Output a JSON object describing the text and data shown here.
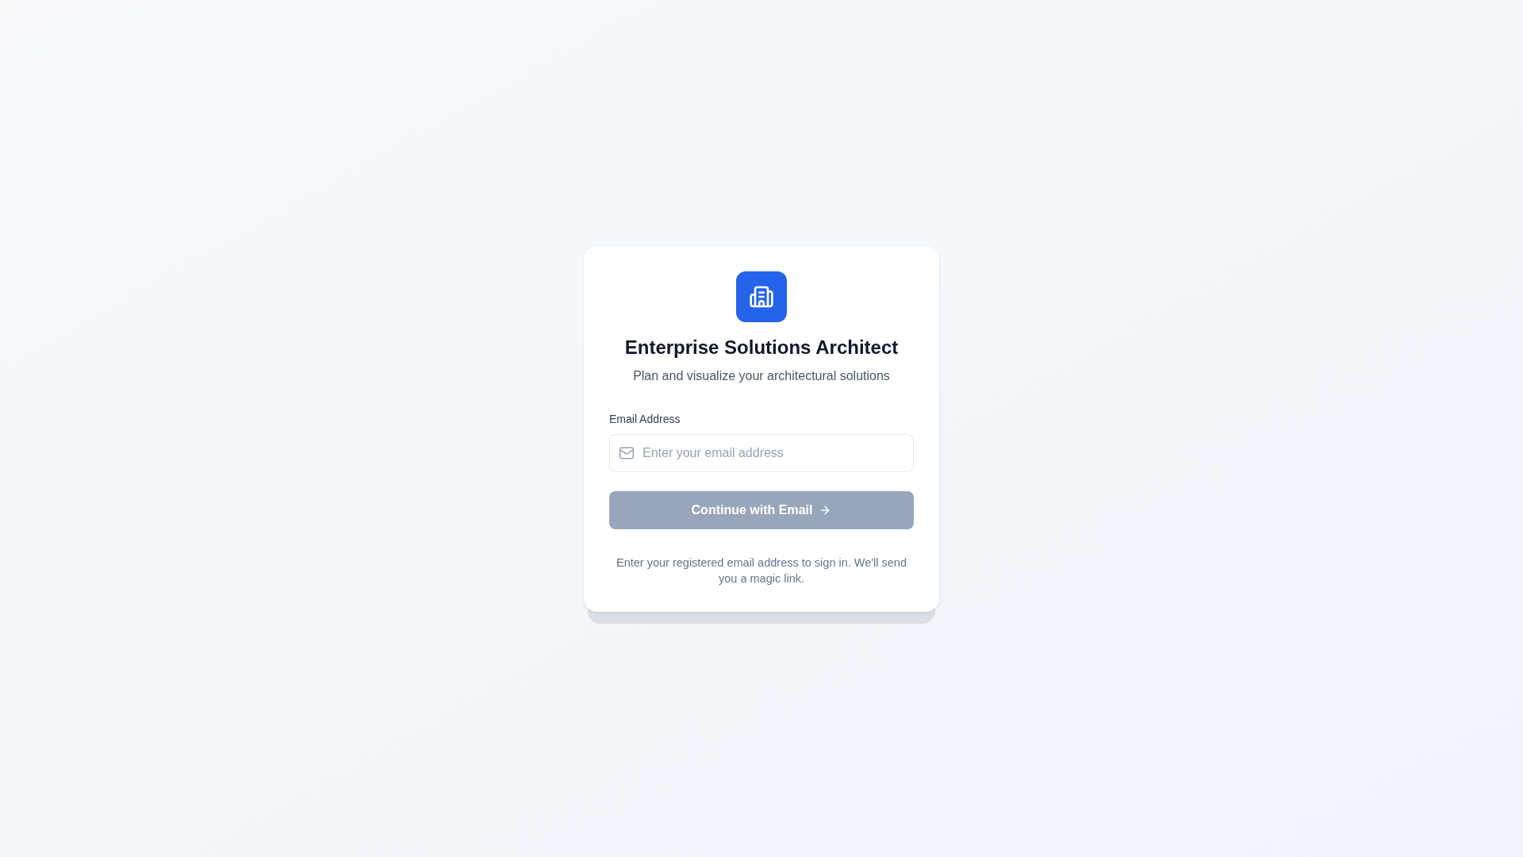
{
  "title": "Enterprise Solutions Architect",
  "subtitle": "Plan and visualize your architectural solutions",
  "email_field": {
    "label": "Email Address",
    "placeholder": "Enter your email address"
  },
  "continue_button": {
    "label": "Continue with Email",
    "disabled": true
  },
  "footer_note": "Enter your registered email address to sign in. We'll send you a magic link."
}
